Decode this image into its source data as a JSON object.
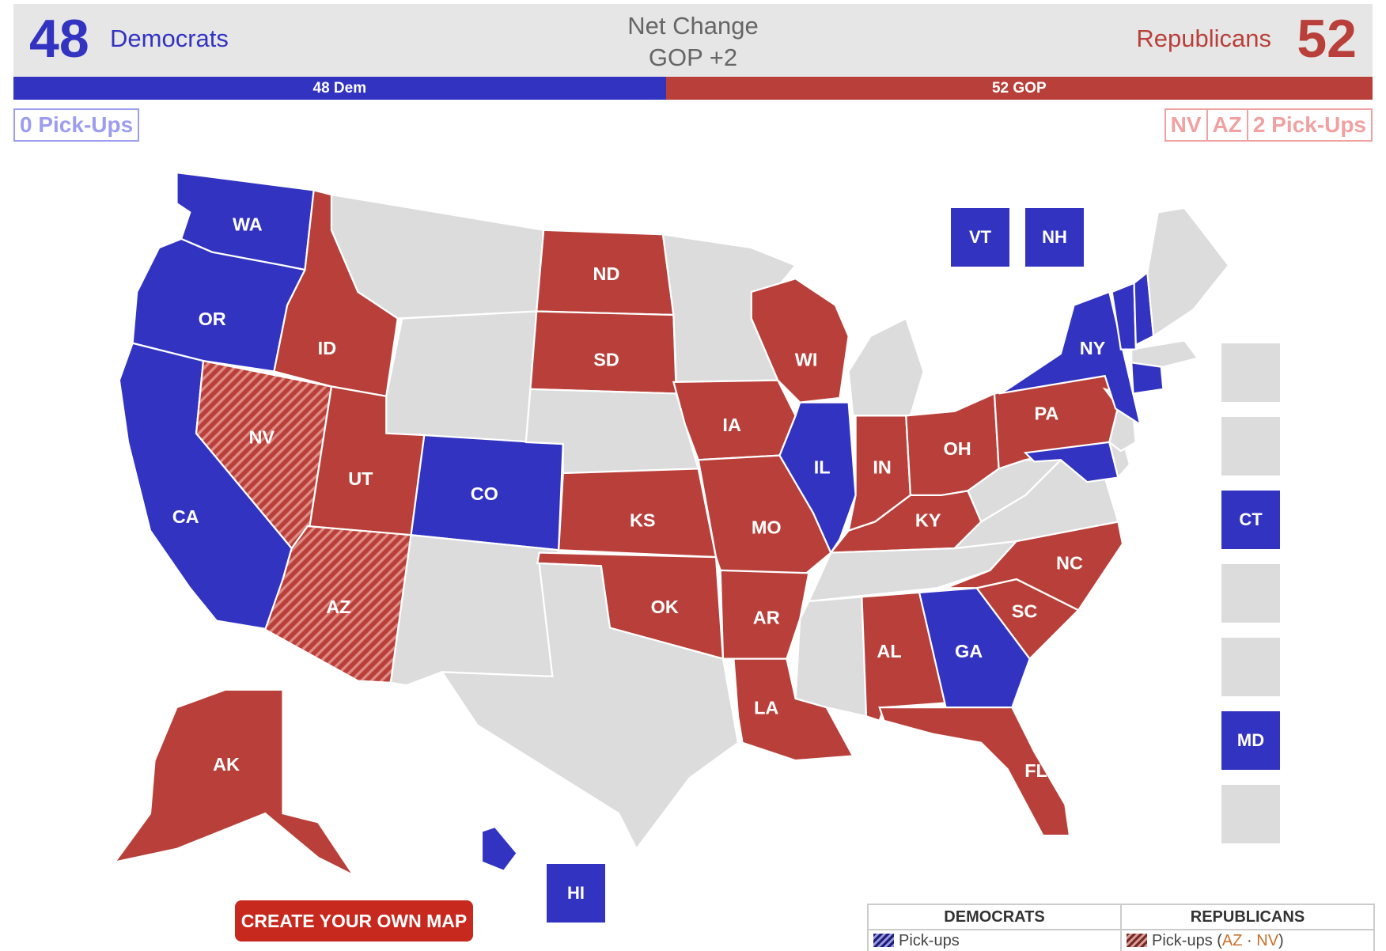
{
  "colors": {
    "dem": "#3333c2",
    "gop": "#b9403a",
    "none": "#dcdcdc",
    "dem_pickup": "#9d9df0",
    "gop_pickup": "#f0a1a1",
    "button": "#c8291e"
  },
  "header": {
    "dem_count": "48",
    "dem_label": "Democrats",
    "net_change_title": "Net Change",
    "net_change_value": "GOP +2",
    "gop_label": "Republicans",
    "gop_count": "52"
  },
  "seat_bar": {
    "dem_label": "48 Dem",
    "gop_label": "52 GOP",
    "dem_seats": 48,
    "gop_seats": 52
  },
  "pickups": {
    "dem": "0 Pick-Ups",
    "gop_states": [
      "NV",
      "AZ"
    ],
    "gop": "2 Pick-Ups"
  },
  "states": {
    "WA": "dem",
    "OR": "dem",
    "CA": "dem",
    "CO": "dem",
    "IL": "dem",
    "NY": "dem",
    "GA": "dem",
    "MD": "dem",
    "CT": "dem",
    "VT": "dem",
    "NH": "dem",
    "HI": "dem",
    "ID": "gop",
    "UT": "gop",
    "ND": "gop",
    "SD": "gop",
    "KS": "gop",
    "OK": "gop",
    "IA": "gop",
    "MO": "gop",
    "AR": "gop",
    "LA": "gop",
    "WI": "gop",
    "IN": "gop",
    "OH": "gop",
    "KY": "gop",
    "PA": "gop",
    "NC": "gop",
    "SC": "gop",
    "AL": "gop",
    "FL": "gop",
    "AK": "gop",
    "NV": "gop-pickup",
    "AZ": "gop-pickup"
  },
  "small_state_boxes": {
    "top": [
      "VT",
      "NH"
    ],
    "side": [
      "",
      "",
      "CT",
      "",
      "",
      "MD",
      ""
    ],
    "hi": "HI"
  },
  "create_button": "CREATE YOUR OWN MAP",
  "legend": {
    "dem_header": "DEMOCRATS",
    "gop_header": "REPUBLICANS",
    "dem_item": "Pick-ups",
    "gop_item": "Pick-ups (",
    "gop_item_states": [
      "AZ",
      "NV"
    ],
    "gop_item_sep": " · ",
    "gop_item_end": ")"
  }
}
